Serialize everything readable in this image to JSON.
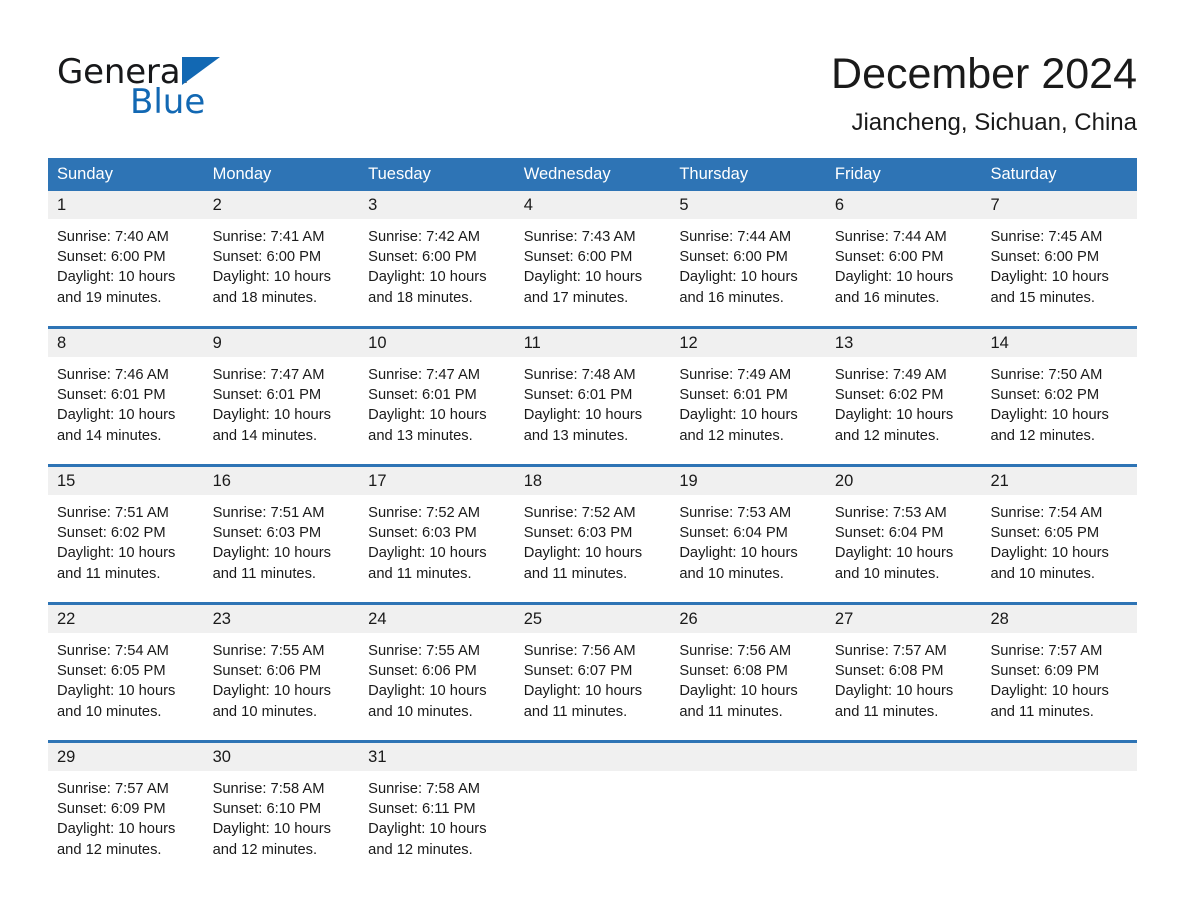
{
  "brand": {
    "name_part1": "General",
    "name_part2": "Blue",
    "triangle_icon": "triangle-icon",
    "accent_color": "#1268b3"
  },
  "header": {
    "title": "December 2024",
    "subtitle": "Jiancheng, Sichuan, China"
  },
  "theme": {
    "header_blue": "#2e74b5",
    "day_band_gray": "#f0f0f0",
    "text_color": "#1a1a1a"
  },
  "calendar": {
    "weekdays": [
      "Sunday",
      "Monday",
      "Tuesday",
      "Wednesday",
      "Thursday",
      "Friday",
      "Saturday"
    ],
    "weeks": [
      [
        {
          "day": "1",
          "sunrise": "Sunrise: 7:40 AM",
          "sunset": "Sunset: 6:00 PM",
          "daylight_line1": "Daylight: 10 hours",
          "daylight_line2": "and 19 minutes."
        },
        {
          "day": "2",
          "sunrise": "Sunrise: 7:41 AM",
          "sunset": "Sunset: 6:00 PM",
          "daylight_line1": "Daylight: 10 hours",
          "daylight_line2": "and 18 minutes."
        },
        {
          "day": "3",
          "sunrise": "Sunrise: 7:42 AM",
          "sunset": "Sunset: 6:00 PM",
          "daylight_line1": "Daylight: 10 hours",
          "daylight_line2": "and 18 minutes."
        },
        {
          "day": "4",
          "sunrise": "Sunrise: 7:43 AM",
          "sunset": "Sunset: 6:00 PM",
          "daylight_line1": "Daylight: 10 hours",
          "daylight_line2": "and 17 minutes."
        },
        {
          "day": "5",
          "sunrise": "Sunrise: 7:44 AM",
          "sunset": "Sunset: 6:00 PM",
          "daylight_line1": "Daylight: 10 hours",
          "daylight_line2": "and 16 minutes."
        },
        {
          "day": "6",
          "sunrise": "Sunrise: 7:44 AM",
          "sunset": "Sunset: 6:00 PM",
          "daylight_line1": "Daylight: 10 hours",
          "daylight_line2": "and 16 minutes."
        },
        {
          "day": "7",
          "sunrise": "Sunrise: 7:45 AM",
          "sunset": "Sunset: 6:00 PM",
          "daylight_line1": "Daylight: 10 hours",
          "daylight_line2": "and 15 minutes."
        }
      ],
      [
        {
          "day": "8",
          "sunrise": "Sunrise: 7:46 AM",
          "sunset": "Sunset: 6:01 PM",
          "daylight_line1": "Daylight: 10 hours",
          "daylight_line2": "and 14 minutes."
        },
        {
          "day": "9",
          "sunrise": "Sunrise: 7:47 AM",
          "sunset": "Sunset: 6:01 PM",
          "daylight_line1": "Daylight: 10 hours",
          "daylight_line2": "and 14 minutes."
        },
        {
          "day": "10",
          "sunrise": "Sunrise: 7:47 AM",
          "sunset": "Sunset: 6:01 PM",
          "daylight_line1": "Daylight: 10 hours",
          "daylight_line2": "and 13 minutes."
        },
        {
          "day": "11",
          "sunrise": "Sunrise: 7:48 AM",
          "sunset": "Sunset: 6:01 PM",
          "daylight_line1": "Daylight: 10 hours",
          "daylight_line2": "and 13 minutes."
        },
        {
          "day": "12",
          "sunrise": "Sunrise: 7:49 AM",
          "sunset": "Sunset: 6:01 PM",
          "daylight_line1": "Daylight: 10 hours",
          "daylight_line2": "and 12 minutes."
        },
        {
          "day": "13",
          "sunrise": "Sunrise: 7:49 AM",
          "sunset": "Sunset: 6:02 PM",
          "daylight_line1": "Daylight: 10 hours",
          "daylight_line2": "and 12 minutes."
        },
        {
          "day": "14",
          "sunrise": "Sunrise: 7:50 AM",
          "sunset": "Sunset: 6:02 PM",
          "daylight_line1": "Daylight: 10 hours",
          "daylight_line2": "and 12 minutes."
        }
      ],
      [
        {
          "day": "15",
          "sunrise": "Sunrise: 7:51 AM",
          "sunset": "Sunset: 6:02 PM",
          "daylight_line1": "Daylight: 10 hours",
          "daylight_line2": "and 11 minutes."
        },
        {
          "day": "16",
          "sunrise": "Sunrise: 7:51 AM",
          "sunset": "Sunset: 6:03 PM",
          "daylight_line1": "Daylight: 10 hours",
          "daylight_line2": "and 11 minutes."
        },
        {
          "day": "17",
          "sunrise": "Sunrise: 7:52 AM",
          "sunset": "Sunset: 6:03 PM",
          "daylight_line1": "Daylight: 10 hours",
          "daylight_line2": "and 11 minutes."
        },
        {
          "day": "18",
          "sunrise": "Sunrise: 7:52 AM",
          "sunset": "Sunset: 6:03 PM",
          "daylight_line1": "Daylight: 10 hours",
          "daylight_line2": "and 11 minutes."
        },
        {
          "day": "19",
          "sunrise": "Sunrise: 7:53 AM",
          "sunset": "Sunset: 6:04 PM",
          "daylight_line1": "Daylight: 10 hours",
          "daylight_line2": "and 10 minutes."
        },
        {
          "day": "20",
          "sunrise": "Sunrise: 7:53 AM",
          "sunset": "Sunset: 6:04 PM",
          "daylight_line1": "Daylight: 10 hours",
          "daylight_line2": "and 10 minutes."
        },
        {
          "day": "21",
          "sunrise": "Sunrise: 7:54 AM",
          "sunset": "Sunset: 6:05 PM",
          "daylight_line1": "Daylight: 10 hours",
          "daylight_line2": "and 10 minutes."
        }
      ],
      [
        {
          "day": "22",
          "sunrise": "Sunrise: 7:54 AM",
          "sunset": "Sunset: 6:05 PM",
          "daylight_line1": "Daylight: 10 hours",
          "daylight_line2": "and 10 minutes."
        },
        {
          "day": "23",
          "sunrise": "Sunrise: 7:55 AM",
          "sunset": "Sunset: 6:06 PM",
          "daylight_line1": "Daylight: 10 hours",
          "daylight_line2": "and 10 minutes."
        },
        {
          "day": "24",
          "sunrise": "Sunrise: 7:55 AM",
          "sunset": "Sunset: 6:06 PM",
          "daylight_line1": "Daylight: 10 hours",
          "daylight_line2": "and 10 minutes."
        },
        {
          "day": "25",
          "sunrise": "Sunrise: 7:56 AM",
          "sunset": "Sunset: 6:07 PM",
          "daylight_line1": "Daylight: 10 hours",
          "daylight_line2": "and 11 minutes."
        },
        {
          "day": "26",
          "sunrise": "Sunrise: 7:56 AM",
          "sunset": "Sunset: 6:08 PM",
          "daylight_line1": "Daylight: 10 hours",
          "daylight_line2": "and 11 minutes."
        },
        {
          "day": "27",
          "sunrise": "Sunrise: 7:57 AM",
          "sunset": "Sunset: 6:08 PM",
          "daylight_line1": "Daylight: 10 hours",
          "daylight_line2": "and 11 minutes."
        },
        {
          "day": "28",
          "sunrise": "Sunrise: 7:57 AM",
          "sunset": "Sunset: 6:09 PM",
          "daylight_line1": "Daylight: 10 hours",
          "daylight_line2": "and 11 minutes."
        }
      ],
      [
        {
          "day": "29",
          "sunrise": "Sunrise: 7:57 AM",
          "sunset": "Sunset: 6:09 PM",
          "daylight_line1": "Daylight: 10 hours",
          "daylight_line2": "and 12 minutes."
        },
        {
          "day": "30",
          "sunrise": "Sunrise: 7:58 AM",
          "sunset": "Sunset: 6:10 PM",
          "daylight_line1": "Daylight: 10 hours",
          "daylight_line2": "and 12 minutes."
        },
        {
          "day": "31",
          "sunrise": "Sunrise: 7:58 AM",
          "sunset": "Sunset: 6:11 PM",
          "daylight_line1": "Daylight: 10 hours",
          "daylight_line2": "and 12 minutes."
        },
        {
          "day": "",
          "sunrise": "",
          "sunset": "",
          "daylight_line1": "",
          "daylight_line2": ""
        },
        {
          "day": "",
          "sunrise": "",
          "sunset": "",
          "daylight_line1": "",
          "daylight_line2": ""
        },
        {
          "day": "",
          "sunrise": "",
          "sunset": "",
          "daylight_line1": "",
          "daylight_line2": ""
        },
        {
          "day": "",
          "sunrise": "",
          "sunset": "",
          "daylight_line1": "",
          "daylight_line2": ""
        }
      ]
    ]
  }
}
